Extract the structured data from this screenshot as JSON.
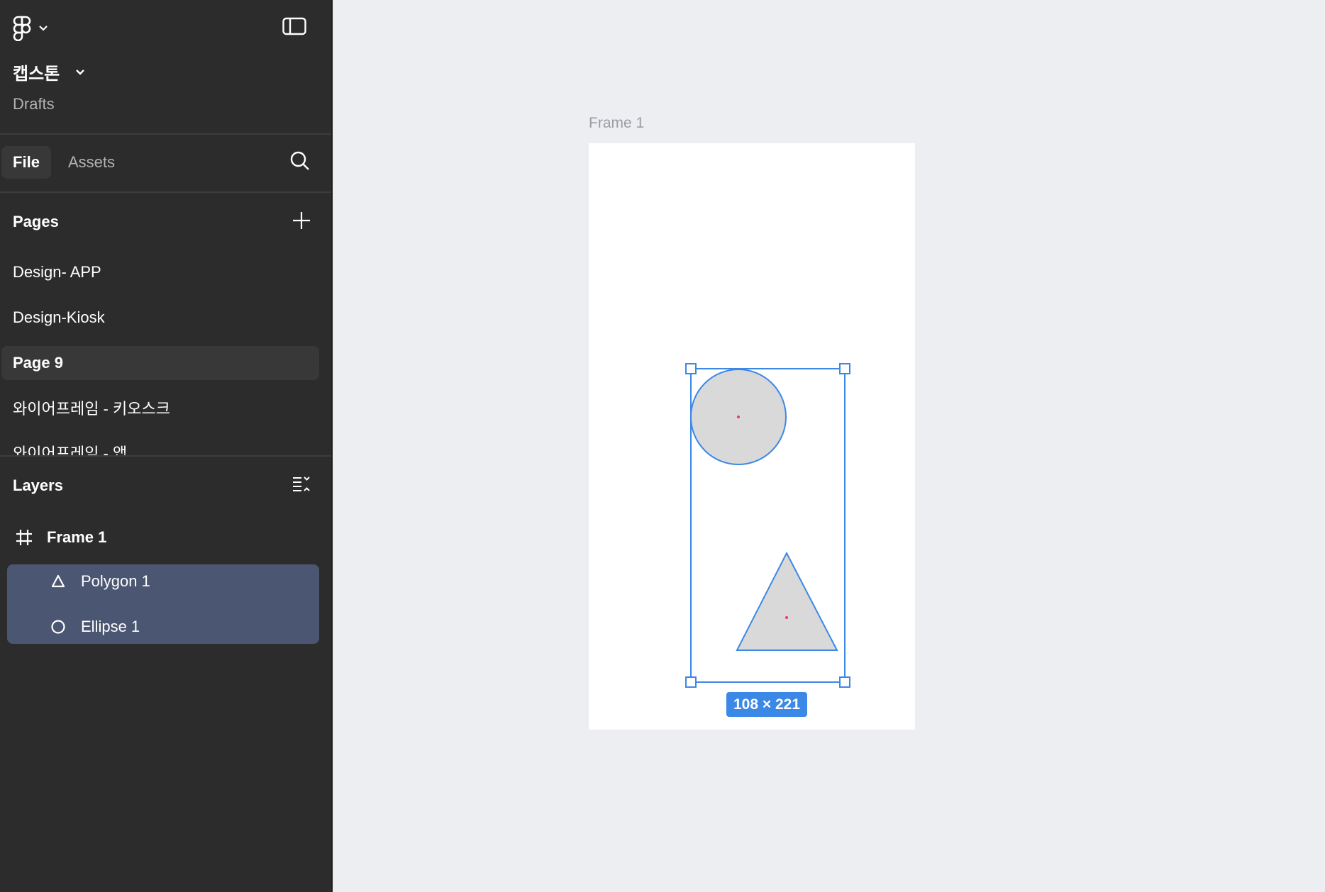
{
  "app": {
    "file_name": "캡스톤",
    "file_location": "Drafts"
  },
  "tabs": {
    "file": "File",
    "assets": "Assets"
  },
  "pages": {
    "title": "Pages",
    "items": [
      {
        "label": "Design- APP",
        "selected": false
      },
      {
        "label": "Design-Kiosk",
        "selected": false
      },
      {
        "label": "Page 9",
        "selected": true
      },
      {
        "label": "와이어프레임 - 키오스크",
        "selected": false
      },
      {
        "label": "와이어프레임 - 앱",
        "selected": false
      }
    ]
  },
  "layers": {
    "title": "Layers",
    "frame": {
      "label": "Frame 1",
      "icon": "frame-hash-icon"
    },
    "children": [
      {
        "label": "Polygon 1",
        "icon": "triangle-icon",
        "selected": true
      },
      {
        "label": "Ellipse 1",
        "icon": "circle-icon",
        "selected": true
      }
    ]
  },
  "canvas": {
    "frame_label": "Frame 1",
    "selection_size": "108 × 221",
    "background_color": "#edeef2",
    "selection_color": "#3b88e6",
    "shape_fill": "#d9d9d9"
  }
}
